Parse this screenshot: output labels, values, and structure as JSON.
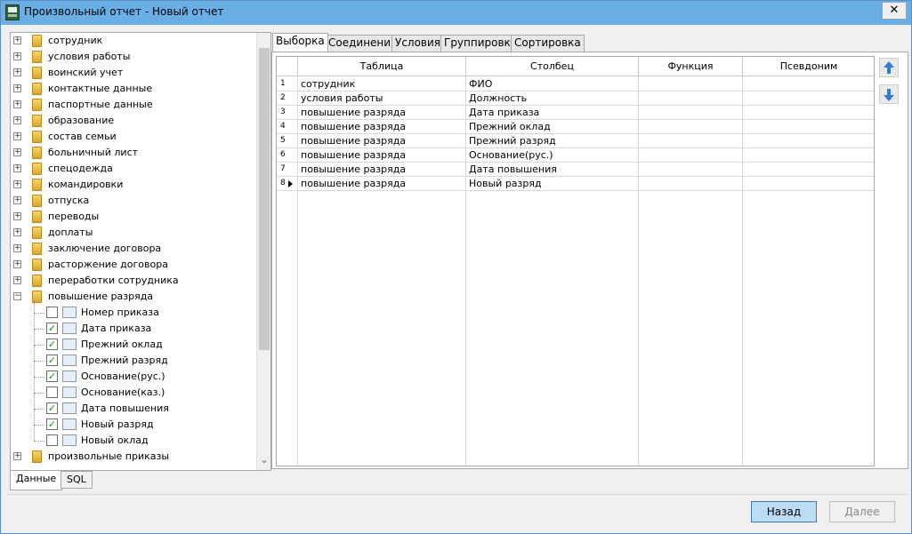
{
  "window": {
    "title": "Произвольный отчет - Новый отчет",
    "close_label": "✕"
  },
  "tree": {
    "folders_before": [
      "сотрудник",
      "условия работы",
      "воинский учет",
      "контактные данные",
      "паспортные данные",
      "образование",
      "состав семьи",
      "больничный лист",
      "спецодежда",
      "командировки",
      "отпуска",
      "переводы",
      "доплаты",
      "заключение договора",
      "расторжение договора",
      "переработки сотрудника"
    ],
    "expanded_folder": "повышение разряда",
    "fields": [
      {
        "label": "Номер приказа",
        "checked": false
      },
      {
        "label": "Дата приказа",
        "checked": true
      },
      {
        "label": "Прежний оклад",
        "checked": true
      },
      {
        "label": "Прежний разряд",
        "checked": true
      },
      {
        "label": "Основание(рус.)",
        "checked": true
      },
      {
        "label": "Основание(каз.)",
        "checked": false
      },
      {
        "label": "Дата повышения",
        "checked": true
      },
      {
        "label": "Новый разряд",
        "checked": true
      },
      {
        "label": "Новый оклад",
        "checked": false
      }
    ],
    "folders_after": [
      "произвольные приказы"
    ]
  },
  "bottom_tabs": [
    {
      "label": "Данные",
      "active": true
    },
    {
      "label": "SQL",
      "active": false
    }
  ],
  "tabs": [
    {
      "label": "Выборка",
      "active": true
    },
    {
      "label": "Соединения",
      "active": false
    },
    {
      "label": "Условия",
      "active": false
    },
    {
      "label": "Группировка",
      "active": false
    },
    {
      "label": "Сортировка",
      "active": false
    }
  ],
  "grid": {
    "columns": [
      "Таблица",
      "Столбец",
      "Функция",
      "Псевдоним"
    ],
    "rows": [
      {
        "num": "1",
        "table": "сотрудник",
        "column": "ФИО",
        "func": "",
        "alias": ""
      },
      {
        "num": "2",
        "table": "условия работы",
        "column": "Должность",
        "func": "",
        "alias": ""
      },
      {
        "num": "3",
        "table": "повышение разряда",
        "column": "Дата приказа",
        "func": "",
        "alias": ""
      },
      {
        "num": "4",
        "table": "повышение разряда",
        "column": "Прежний оклад",
        "func": "",
        "alias": ""
      },
      {
        "num": "5",
        "table": "повышение разряда",
        "column": "Прежний разряд",
        "func": "",
        "alias": ""
      },
      {
        "num": "6",
        "table": "повышение разряда",
        "column": "Основание(рус.)",
        "func": "",
        "alias": ""
      },
      {
        "num": "7",
        "table": "повышение разряда",
        "column": "Дата повышения",
        "func": "",
        "alias": ""
      },
      {
        "num": "8",
        "table": "повышение разряда",
        "column": "Новый разряд",
        "func": "",
        "alias": "",
        "current": true
      }
    ]
  },
  "side_buttons": {
    "up_icon": "arrow-up-icon",
    "down_icon": "arrow-down-icon"
  },
  "footer": {
    "back_label": "Назад",
    "next_label": "Далее"
  }
}
